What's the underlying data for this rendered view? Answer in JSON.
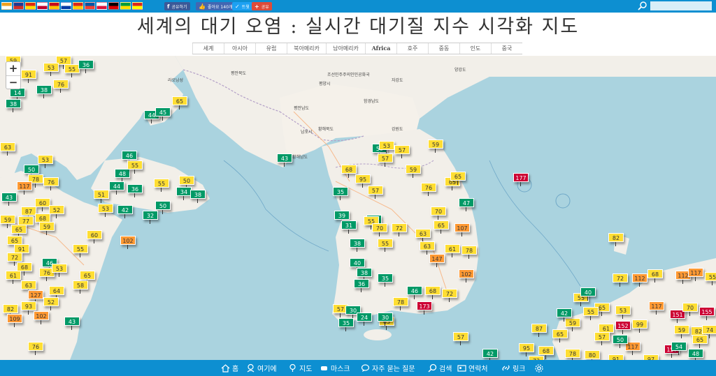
{
  "header": {
    "title": "세계의 대기 오염 : 실시간 대기질 지수 시각화 지도",
    "share_facebook": "공유하기",
    "share_like": "좋아요 140개",
    "share_twitter": "트윗",
    "share_google": "공유",
    "search_placeholder": ""
  },
  "flags": [
    {
      "name": "flag-kazakhstan",
      "c1": "#f0a020",
      "c2": "#ffffff"
    },
    {
      "name": "flag-uk",
      "c1": "#1f3a93",
      "c2": "#d22f27"
    },
    {
      "name": "flag-china",
      "c1": "#de2910",
      "c2": "#ffde00"
    },
    {
      "name": "flag-japan",
      "c1": "#ffffff",
      "c2": "#bc002d"
    },
    {
      "name": "flag-spain",
      "c1": "#c60b1e",
      "c2": "#ffc400"
    },
    {
      "name": "flag-russia",
      "c1": "#ffffff",
      "c2": "#0039a6"
    },
    {
      "name": "flag-vietnam-alt",
      "c1": "#da251d",
      "c2": "#ffcd00"
    },
    {
      "name": "flag-france",
      "c1": "#0055a4",
      "c2": "#ef4135"
    },
    {
      "name": "flag-poland",
      "c1": "#ffffff",
      "c2": "#dc143c"
    },
    {
      "name": "flag-germany",
      "c1": "#000000",
      "c2": "#dd0000"
    },
    {
      "name": "flag-brazil",
      "c1": "#009c3b",
      "c2": "#ffdf00"
    },
    {
      "name": "flag-vietnam",
      "c1": "#da251d",
      "c2": "#ffff00"
    }
  ],
  "nav": [
    {
      "label": "세계"
    },
    {
      "label": "아시아"
    },
    {
      "label": "유럽"
    },
    {
      "label": "북아메리카"
    },
    {
      "label": "남아메리카"
    },
    {
      "label": "Africa"
    },
    {
      "label": "호주"
    },
    {
      "label": "중동"
    },
    {
      "label": "인도"
    },
    {
      "label": "중국"
    }
  ],
  "map": {
    "zoom_in": "+",
    "zoom_out": "−",
    "labels": [
      "조선민주주의인민공화국",
      "평양시",
      "남포시",
      "황해북도",
      "황해남도",
      "강원도",
      "함경남도",
      "평안남도",
      "평안북도",
      "자강도",
      "양강도",
      "라오닝성"
    ]
  },
  "aqi_colors": {
    "good": "#009966",
    "moderate": "#ffde33",
    "usg": "#ff9933",
    "unhealthy": "#cc0033"
  },
  "stations": [
    {
      "v": "59",
      "c": "mod"
    },
    {
      "v": "57",
      "c": "mod"
    },
    {
      "v": "53",
      "c": "mod"
    },
    {
      "v": "55",
      "c": "mod"
    },
    {
      "v": "36",
      "c": "good"
    },
    {
      "v": "91",
      "c": "mod"
    },
    {
      "v": "38",
      "c": "good"
    },
    {
      "v": "76",
      "c": "mod"
    },
    {
      "v": "14",
      "c": "good"
    },
    {
      "v": "38",
      "c": "good"
    },
    {
      "v": "65",
      "c": "mod"
    },
    {
      "v": "44",
      "c": "good"
    },
    {
      "v": "45",
      "c": "good"
    },
    {
      "v": "63",
      "c": "mod"
    },
    {
      "v": "53",
      "c": "mod"
    },
    {
      "v": "50",
      "c": "good"
    },
    {
      "v": "46",
      "c": "good"
    },
    {
      "v": "48",
      "c": "good"
    },
    {
      "v": "55",
      "c": "mod"
    },
    {
      "v": "50",
      "c": "mod"
    },
    {
      "v": "55",
      "c": "mod"
    },
    {
      "v": "34",
      "c": "good"
    },
    {
      "v": "38",
      "c": "good"
    },
    {
      "v": "78",
      "c": "mod"
    },
    {
      "v": "76",
      "c": "mod"
    },
    {
      "v": "117",
      "c": "usg"
    },
    {
      "v": "44",
      "c": "good"
    },
    {
      "v": "36",
      "c": "good"
    },
    {
      "v": "51",
      "c": "mod"
    },
    {
      "v": "43",
      "c": "good"
    },
    {
      "v": "53",
      "c": "mod"
    },
    {
      "v": "42",
      "c": "good"
    },
    {
      "v": "50",
      "c": "good"
    },
    {
      "v": "32",
      "c": "good"
    },
    {
      "v": "60",
      "c": "mod"
    },
    {
      "v": "52",
      "c": "mod"
    },
    {
      "v": "87",
      "c": "mod"
    },
    {
      "v": "59",
      "c": "mod"
    },
    {
      "v": "77",
      "c": "mod"
    },
    {
      "v": "68",
      "c": "mod"
    },
    {
      "v": "65",
      "c": "mod"
    },
    {
      "v": "59",
      "c": "mod"
    },
    {
      "v": "65",
      "c": "mod"
    },
    {
      "v": "91",
      "c": "mod"
    },
    {
      "v": "72",
      "c": "mod"
    },
    {
      "v": "60",
      "c": "mod"
    },
    {
      "v": "102",
      "c": "usg"
    },
    {
      "v": "55",
      "c": "mod"
    },
    {
      "v": "68",
      "c": "mod"
    },
    {
      "v": "46",
      "c": "good"
    },
    {
      "v": "76",
      "c": "mod"
    },
    {
      "v": "53",
      "c": "mod"
    },
    {
      "v": "65",
      "c": "mod"
    },
    {
      "v": "61",
      "c": "mod"
    },
    {
      "v": "58",
      "c": "mod"
    },
    {
      "v": "63",
      "c": "mod"
    },
    {
      "v": "64",
      "c": "mod"
    },
    {
      "v": "127",
      "c": "usg"
    },
    {
      "v": "52",
      "c": "mod"
    },
    {
      "v": "82",
      "c": "mod"
    },
    {
      "v": "93",
      "c": "mod"
    },
    {
      "v": "109",
      "c": "usg"
    },
    {
      "v": "102",
      "c": "usg"
    },
    {
      "v": "43",
      "c": "good"
    },
    {
      "v": "76",
      "c": "mod"
    },
    {
      "v": "43",
      "c": "good"
    },
    {
      "v": "50",
      "c": "good"
    },
    {
      "v": "53",
      "c": "mod"
    },
    {
      "v": "57",
      "c": "mod"
    },
    {
      "v": "59",
      "c": "mod"
    },
    {
      "v": "68",
      "c": "mod"
    },
    {
      "v": "57",
      "c": "mod"
    },
    {
      "v": "59",
      "c": "mod"
    },
    {
      "v": "95",
      "c": "mod"
    },
    {
      "v": "57",
      "c": "mod"
    },
    {
      "v": "35",
      "c": "good"
    },
    {
      "v": "65",
      "c": "mod"
    },
    {
      "v": "70",
      "c": "mod"
    },
    {
      "v": "76",
      "c": "mod"
    },
    {
      "v": "65",
      "c": "mod"
    },
    {
      "v": "47",
      "c": "good"
    },
    {
      "v": "42",
      "c": "good"
    },
    {
      "v": "39",
      "c": "good"
    },
    {
      "v": "31",
      "c": "good"
    },
    {
      "v": "55",
      "c": "mod"
    },
    {
      "v": "70",
      "c": "mod"
    },
    {
      "v": "72",
      "c": "mod"
    },
    {
      "v": "63",
      "c": "mod"
    },
    {
      "v": "65",
      "c": "mod"
    },
    {
      "v": "107",
      "c": "usg"
    },
    {
      "v": "38",
      "c": "good"
    },
    {
      "v": "55",
      "c": "mod"
    },
    {
      "v": "63",
      "c": "mod"
    },
    {
      "v": "61",
      "c": "mod"
    },
    {
      "v": "78",
      "c": "mod"
    },
    {
      "v": "147",
      "c": "usg"
    },
    {
      "v": "102",
      "c": "usg"
    },
    {
      "v": "40",
      "c": "good"
    },
    {
      "v": "38",
      "c": "good"
    },
    {
      "v": "35",
      "c": "good"
    },
    {
      "v": "36",
      "c": "good"
    },
    {
      "v": "46",
      "c": "good"
    },
    {
      "v": "68",
      "c": "mod"
    },
    {
      "v": "72",
      "c": "mod"
    },
    {
      "v": "78",
      "c": "mod"
    },
    {
      "v": "173",
      "c": "unh"
    },
    {
      "v": "57",
      "c": "mod"
    },
    {
      "v": "30",
      "c": "good"
    },
    {
      "v": "63",
      "c": "mod"
    },
    {
      "v": "35",
      "c": "good"
    },
    {
      "v": "24",
      "c": "good"
    },
    {
      "v": "30",
      "c": "good"
    },
    {
      "v": "177",
      "c": "unh"
    },
    {
      "v": "82",
      "c": "mod"
    },
    {
      "v": "72",
      "c": "mod"
    },
    {
      "v": "112",
      "c": "usg"
    },
    {
      "v": "68",
      "c": "mod"
    },
    {
      "v": "112",
      "c": "usg"
    },
    {
      "v": "117",
      "c": "usg"
    },
    {
      "v": "55",
      "c": "mod"
    },
    {
      "v": "65",
      "c": "mod"
    },
    {
      "v": "53",
      "c": "mod"
    },
    {
      "v": "59",
      "c": "mod"
    },
    {
      "v": "42",
      "c": "good"
    },
    {
      "v": "55",
      "c": "mod"
    },
    {
      "v": "61",
      "c": "mod"
    },
    {
      "v": "152",
      "c": "unh"
    },
    {
      "v": "99",
      "c": "mod"
    },
    {
      "v": "117",
      "c": "usg"
    },
    {
      "v": "151",
      "c": "unh"
    },
    {
      "v": "70",
      "c": "mod"
    },
    {
      "v": "155",
      "c": "unh"
    },
    {
      "v": "87",
      "c": "mod"
    },
    {
      "v": "95",
      "c": "mod"
    },
    {
      "v": "68",
      "c": "mod"
    },
    {
      "v": "78",
      "c": "mod"
    },
    {
      "v": "80",
      "c": "mod"
    },
    {
      "v": "117",
      "c": "usg"
    },
    {
      "v": "157",
      "c": "unh"
    },
    {
      "v": "82",
      "c": "mod"
    },
    {
      "v": "74",
      "c": "mod"
    },
    {
      "v": "59",
      "c": "mod"
    },
    {
      "v": "65",
      "c": "mod"
    },
    {
      "v": "72",
      "c": "mod"
    },
    {
      "v": "91",
      "c": "mod"
    },
    {
      "v": "97",
      "c": "mod"
    },
    {
      "v": "57",
      "c": "mod"
    },
    {
      "v": "42",
      "c": "good"
    },
    {
      "v": "40",
      "c": "good"
    },
    {
      "v": "50",
      "c": "good"
    },
    {
      "v": "55",
      "c": "mod"
    },
    {
      "v": "54",
      "c": "good"
    },
    {
      "v": "48",
      "c": "good"
    },
    {
      "v": "57",
      "c": "mod"
    },
    {
      "v": "65",
      "c": "mod"
    }
  ],
  "bottom_nav": [
    {
      "label": "홈",
      "icon": "home-icon"
    },
    {
      "label": "여기에",
      "icon": "location-pin-icon"
    },
    {
      "label": "지도",
      "icon": "map-pin-icon"
    },
    {
      "label": "마스크",
      "icon": "mask-icon"
    },
    {
      "label": "자주 묻는 질문",
      "icon": "faq-bubble-icon"
    },
    {
      "label": "검색",
      "icon": "search-icon"
    },
    {
      "label": "연락처",
      "icon": "contact-icon"
    },
    {
      "label": "링크",
      "icon": "link-icon"
    },
    {
      "label": "",
      "icon": "settings-gear-icon"
    }
  ]
}
